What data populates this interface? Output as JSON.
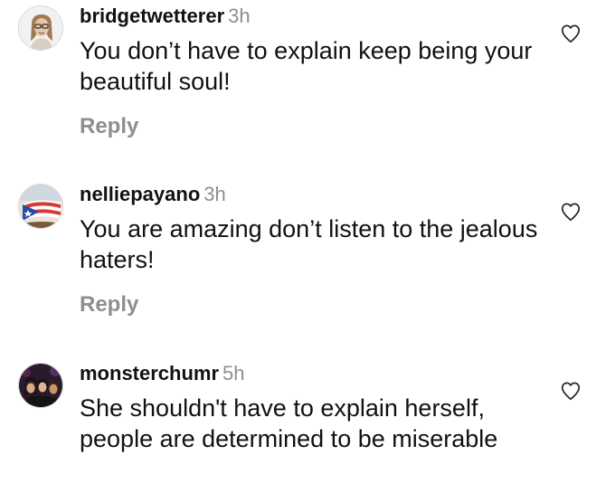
{
  "comments": [
    {
      "username": "bridgetwetterer",
      "time": "3h",
      "text": "You don’t have to explain keep being your beautiful soul!",
      "reply_label": "Reply",
      "avatar_icon": "person-with-glasses-avatar"
    },
    {
      "username": "nelliepayano",
      "time": "3h",
      "text": "You are amazing don’t listen to the jealous haters!",
      "reply_label": "Reply",
      "avatar_icon": "puerto-rico-flag-avatar"
    },
    {
      "username": "monsterchumr",
      "time": "5h",
      "text": "She shouldn't have to explain herself, people are determined to be miserable",
      "reply_label": "",
      "avatar_icon": "group-photo-avatar"
    }
  ],
  "like_icon": "heart-outline-icon",
  "colors": {
    "text": "#111111",
    "muted": "#8e8e8e"
  }
}
